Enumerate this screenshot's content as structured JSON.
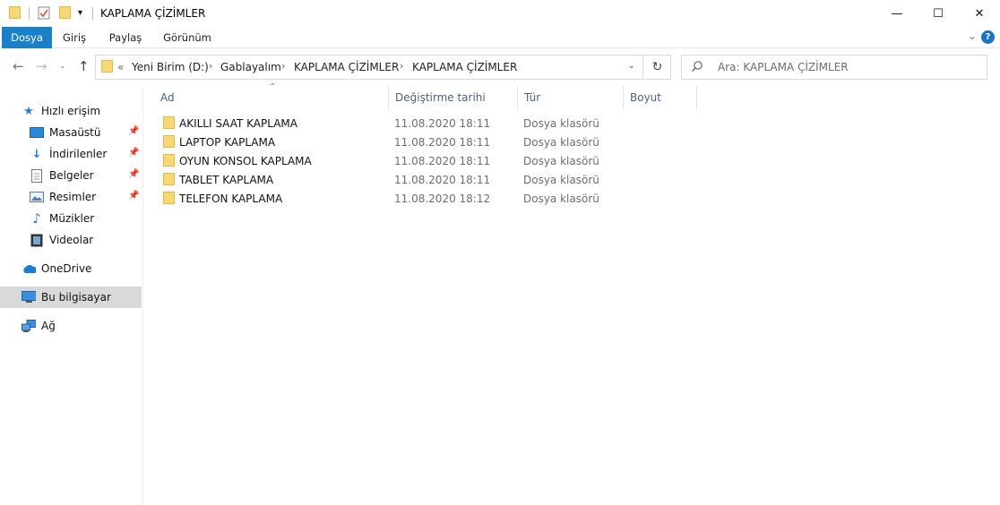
{
  "window": {
    "title": "KAPLAMA ÇİZİMLER",
    "minimize_glyph": "—",
    "maximize_glyph": "☐",
    "close_glyph": "✕"
  },
  "ribbon": {
    "tabs": [
      "Dosya",
      "Giriş",
      "Paylaş",
      "Görünüm"
    ],
    "active_tab": "Dosya",
    "active_color": "#1a80c8",
    "help_glyph": "?"
  },
  "address": {
    "overflow": "«",
    "breadcrumb": [
      "Yeni Birim (D:)",
      "Gablayalım",
      "KAPLAMA ÇİZİMLER",
      "KAPLAMA ÇİZİMLER"
    ],
    "separator": "›",
    "search_placeholder": "Ara: KAPLAMA ÇİZİMLER"
  },
  "navpane": {
    "items": [
      {
        "label": "Hızlı erişim",
        "icon": "star-icon",
        "pinned": false
      },
      {
        "label": "Masaüstü",
        "icon": "desktop-icon",
        "pinned": true
      },
      {
        "label": "İndirilenler",
        "icon": "download-icon",
        "pinned": true
      },
      {
        "label": "Belgeler",
        "icon": "document-icon",
        "pinned": true
      },
      {
        "label": "Resimler",
        "icon": "pictures-icon",
        "pinned": true
      },
      {
        "label": "Müzikler",
        "icon": "music-icon",
        "pinned": false
      },
      {
        "label": "Videolar",
        "icon": "video-icon",
        "pinned": false
      },
      {
        "label": "OneDrive",
        "icon": "cloud-icon",
        "pinned": false
      },
      {
        "label": "Bu bilgisayar",
        "icon": "computer-icon",
        "pinned": false,
        "selected": true
      },
      {
        "label": "Ağ",
        "icon": "network-icon",
        "pinned": false
      }
    ]
  },
  "filelist": {
    "columns": [
      "Ad",
      "Değiştirme tarihi",
      "Tür",
      "Boyut"
    ],
    "sort_column": "Ad",
    "rows": [
      {
        "name": "AKILLI SAAT KAPLAMA",
        "date": "11.08.2020 18:11",
        "type": "Dosya klasörü"
      },
      {
        "name": "LAPTOP KAPLAMA",
        "date": "11.08.2020 18:11",
        "type": "Dosya klasörü"
      },
      {
        "name": "OYUN KONSOL KAPLAMA",
        "date": "11.08.2020 18:11",
        "type": "Dosya klasörü"
      },
      {
        "name": "TABLET KAPLAMA",
        "date": "11.08.2020 18:11",
        "type": "Dosya klasörü"
      },
      {
        "name": "TELEFON KAPLAMA",
        "date": "11.08.2020 18:12",
        "type": "Dosya klasörü"
      }
    ]
  }
}
